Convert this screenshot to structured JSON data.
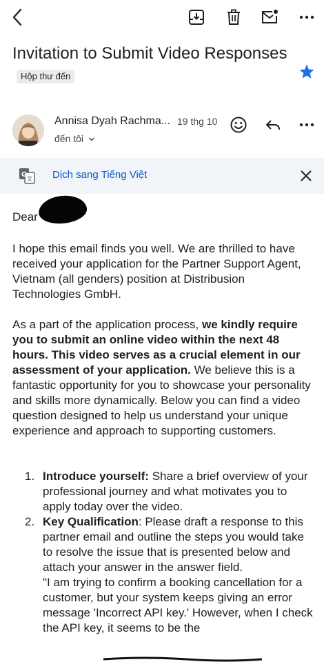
{
  "subject": {
    "title": "Invitation to Submit Video Responses",
    "folder_badge": "Hộp thư đến"
  },
  "sender": {
    "name": "Annisa Dyah Rachma...",
    "date": "19 thg 10",
    "to": "đến tôi"
  },
  "translate_bar": {
    "label": "Dịch sang Tiếng Việt"
  },
  "body": {
    "greeting": "Dear",
    "p1": "I hope this email finds you well. We are thrilled to have received your application for the Partner Support Agent, Vietnam (all genders) position at Distribusion Technologies GmbH.",
    "p2_lead": "As a part of the application process, ",
    "p2_bold": "we kindly require you to submit an online video within the next 48 hours. This video serves as a crucial element in our assessment of your application.",
    "p2_rest": " We believe this is a fantastic opportunity for you to showcase your personality and skills more dynamically.  Below you can find a video question designed to help us understand your unique experience and approach to supporting customers.",
    "items": [
      {
        "number": "1.",
        "title": "Introduce yourself:",
        "text": " Share a brief overview of your professional journey and what motivates you to apply today over the video."
      },
      {
        "number": "2.",
        "title": "Key Qualification",
        "text": ": Please draft a response to this partner email and outline the steps you would take to resolve the issue that is presented below and attach your answer in the answer field.",
        "quote": "\"I am trying to confirm a booking cancellation for a customer, but your system keeps giving an error message 'Incorrect API key.' However, when I check the API key, it seems to be the"
      }
    ]
  },
  "colors": {
    "accent_blue": "#0b57d0",
    "star_blue": "#1a73e8",
    "translate_bg": "#f1f4f8",
    "text": "#1f1f1f"
  }
}
